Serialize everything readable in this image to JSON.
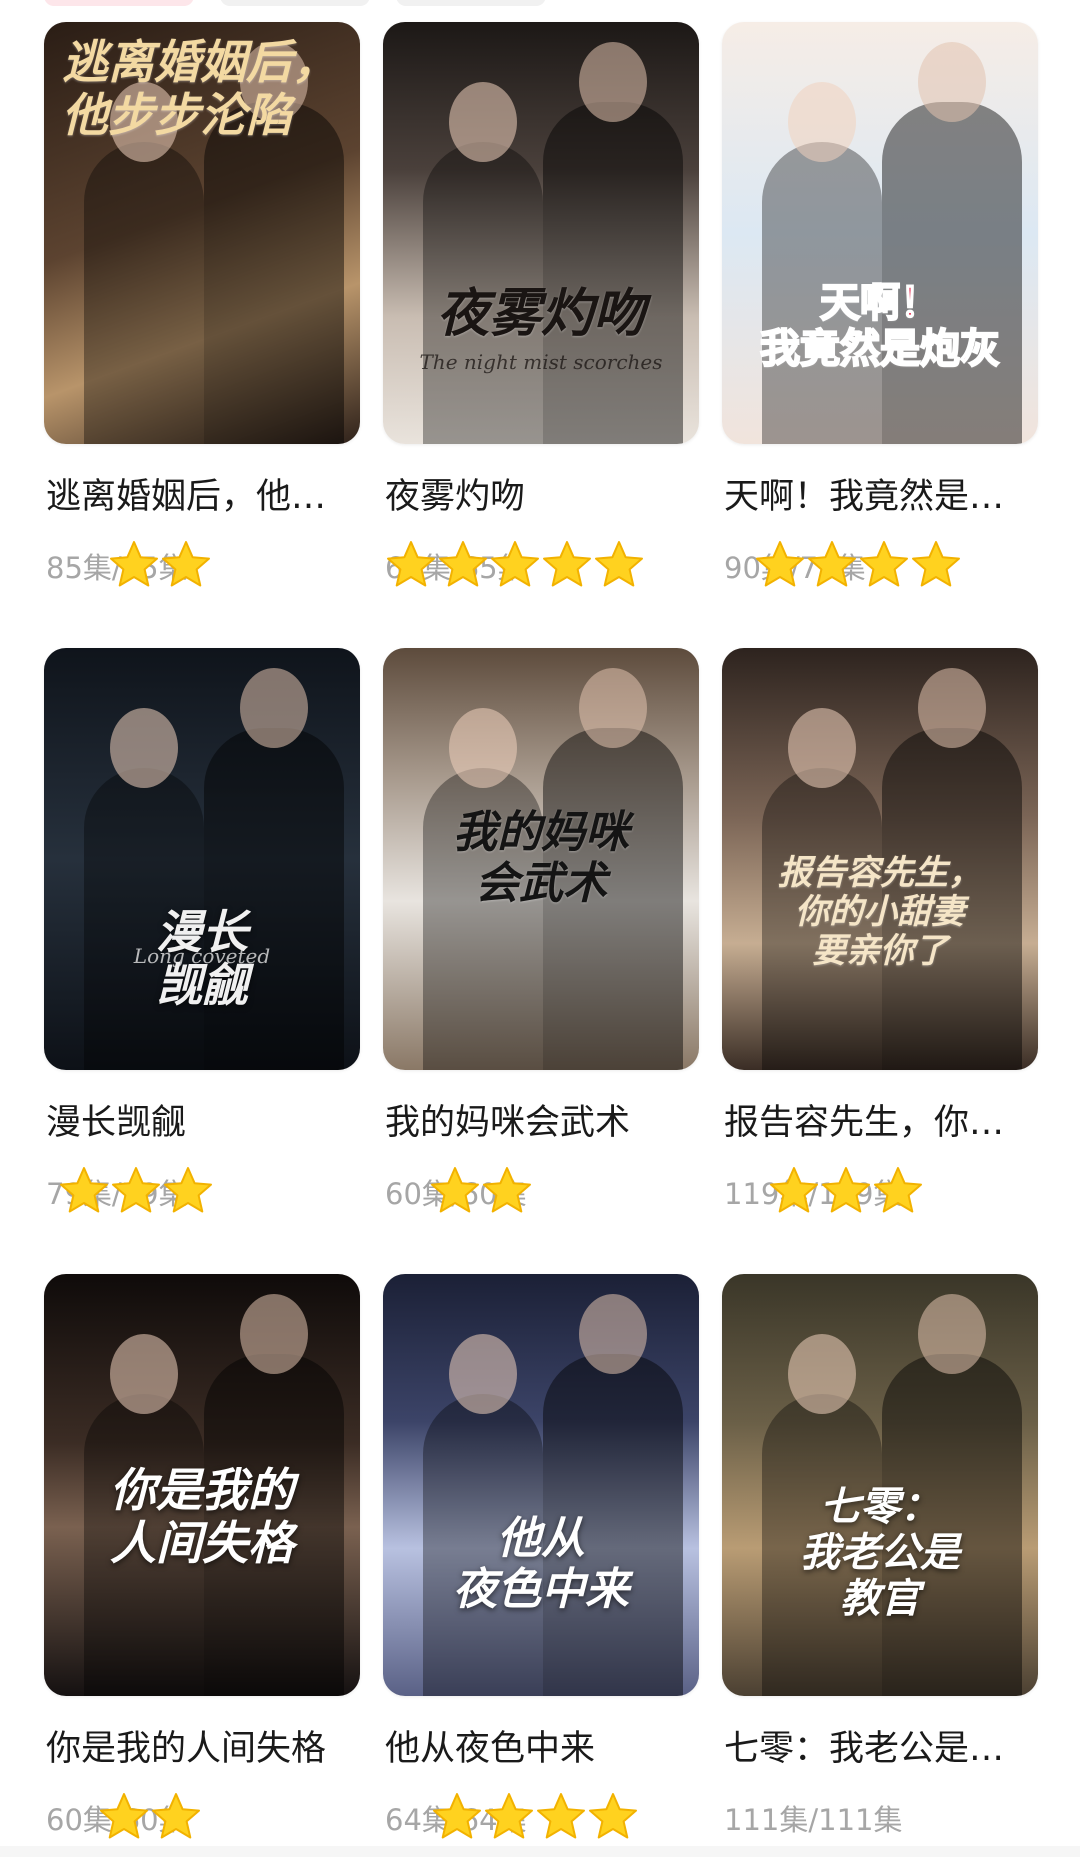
{
  "dramas": [
    {
      "title": "逃离婚姻后，他步步沦陷",
      "episodes": "85集/85集",
      "rating": 2,
      "poster_title": "逃离婚姻后，\n他步步沦陷",
      "poster_sub": "",
      "colors": {
        "bg1": "#3a2a1f",
        "bg2": "#8a6a4a",
        "accent": "#e9c98a"
      }
    },
    {
      "title": "夜雾灼吻",
      "episodes": "65集/65集",
      "rating": 5,
      "poster_title": "夜雾灼吻",
      "poster_sub": "The night mist scorches",
      "colors": {
        "bg1": "#2b2624",
        "bg2": "#9c8f86",
        "accent": "#f3ece4"
      }
    },
    {
      "title": "天啊！我竟然是炮灰",
      "episodes": "90集/79集",
      "rating": 4,
      "poster_title": "天啊！\n我竟然是炮灰",
      "poster_sub": "",
      "colors": {
        "bg1": "#f3e7df",
        "bg2": "#c9d9ea",
        "accent": "#e0143c"
      }
    },
    {
      "title": "漫长觊觎",
      "episodes": "79集/79集",
      "rating": 3,
      "poster_title": "漫长\n觊觎",
      "poster_sub": "Long coveted",
      "colors": {
        "bg1": "#10151d",
        "bg2": "#3b4a5a",
        "accent": "#e8e8e8"
      }
    },
    {
      "title": "我的妈咪会武术",
      "episodes": "60集/60集",
      "rating": 2,
      "poster_title": "我的妈咪\n会武术",
      "poster_sub": "",
      "colors": {
        "bg1": "#6b5a4a",
        "bg2": "#d9d4cf",
        "accent": "#1a1a1a"
      }
    },
    {
      "title": "报告容先生，你的小甜妻要亲你了",
      "episodes": "119集/119集",
      "rating": 3,
      "poster_title": "报告容先生，\n你的小甜妻\n要亲你了",
      "poster_sub": "",
      "colors": {
        "bg1": "#3b2e28",
        "bg2": "#a08978",
        "accent": "#f2e3c8"
      }
    },
    {
      "title": "你是我的人间失格",
      "episodes": "60集/60集",
      "rating": 0,
      "poster_title": "你是我的\n人间失格",
      "poster_sub": "",
      "colors": {
        "bg1": "#120e0d",
        "bg2": "#5e4738",
        "accent": "#ffffff"
      }
    },
    {
      "title": "他从夜色中来",
      "episodes": "64集/64集",
      "rating": 0,
      "poster_title": "他从\n夜色中来",
      "poster_sub": "",
      "colors": {
        "bg1": "#1c2034",
        "bg2": "#9aa5c8",
        "accent": "#ffffff"
      }
    },
    {
      "title": "七零：我老公是教官",
      "episodes": "111集/111集",
      "rating": 0,
      "poster_title": "七零：\n我老公是\n教官",
      "poster_sub": "",
      "colors": {
        "bg1": "#3e3a2b",
        "bg2": "#c2a37a",
        "accent": "#ffffff"
      }
    }
  ],
  "extra_stars": [
    {
      "card": 6,
      "count": 2
    },
    {
      "card": 7,
      "count": 2
    },
    {
      "card": 8,
      "count": 4
    }
  ],
  "icons": {
    "star": "star-icon"
  },
  "colors": {
    "star_fill": "#ffd21f",
    "star_stroke": "#f2b200",
    "title_text": "#1a1a1a",
    "meta_text": "#a6a6a6"
  }
}
